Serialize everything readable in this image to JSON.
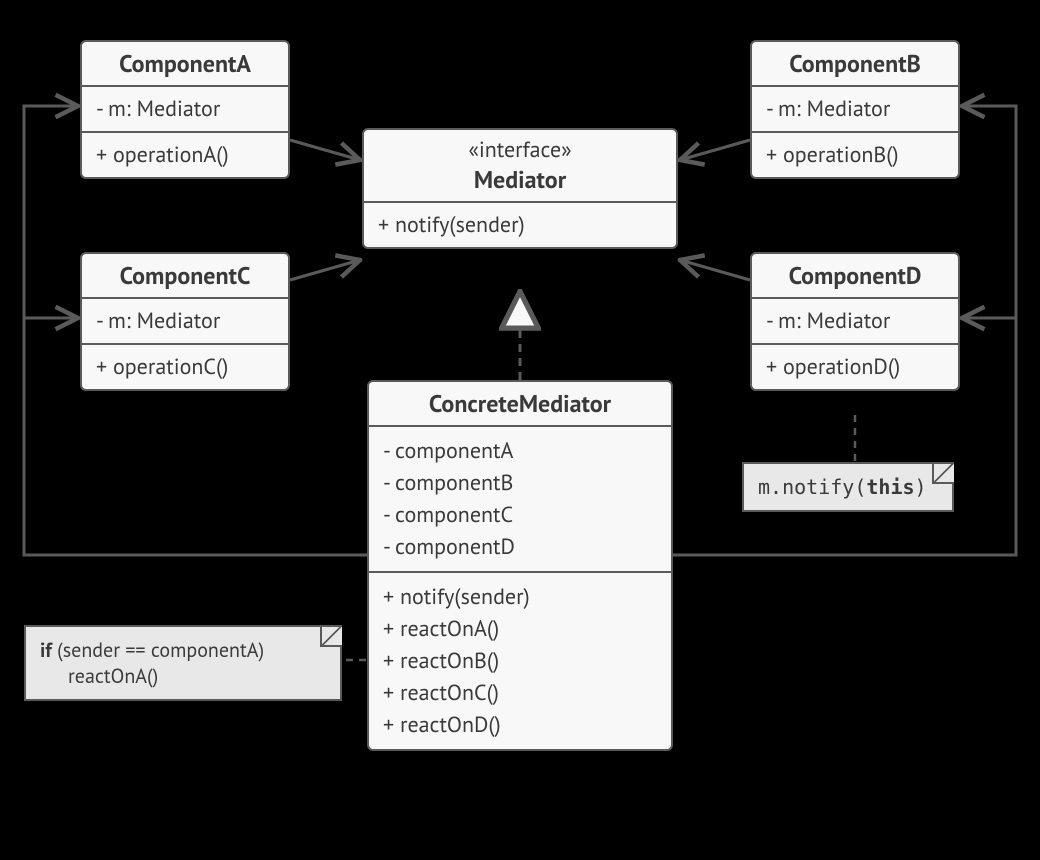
{
  "pattern": "Mediator",
  "classes": {
    "ComponentA": {
      "name": "ComponentA",
      "fields": [
        "- m: Mediator"
      ],
      "methods": [
        "+ operationA()"
      ]
    },
    "ComponentB": {
      "name": "ComponentB",
      "fields": [
        "- m: Mediator"
      ],
      "methods": [
        "+ operationB()"
      ]
    },
    "ComponentC": {
      "name": "ComponentC",
      "fields": [
        "- m: Mediator"
      ],
      "methods": [
        "+ operationC()"
      ]
    },
    "ComponentD": {
      "name": "ComponentD",
      "fields": [
        "- m: Mediator"
      ],
      "methods": [
        "+ operationD()"
      ]
    },
    "Mediator": {
      "stereotype": "«interface»",
      "name": "Mediator",
      "methods": [
        "+ notify(sender)"
      ]
    },
    "ConcreteMediator": {
      "name": "ConcreteMediator",
      "fields": [
        "- componentA",
        "- componentB",
        "- componentC",
        "- componentD"
      ],
      "methods": [
        "+ notify(sender)",
        "+ reactOnA()",
        "+ reactOnB()",
        "+ reactOnC()",
        "+ reactOnD()"
      ]
    }
  },
  "notes": {
    "noteD": {
      "prefix": "m.notify(",
      "bold": "this",
      "suffix": ")"
    },
    "noteNotify": {
      "kw": "if",
      "cond": " (sender == componentA)",
      "body": "reactOnA()"
    }
  },
  "colors": {
    "line": "#5a5a5a",
    "boxBg": "#f8f8f8",
    "noteBg": "#e8e8e8",
    "canvasBg": "#000000"
  }
}
